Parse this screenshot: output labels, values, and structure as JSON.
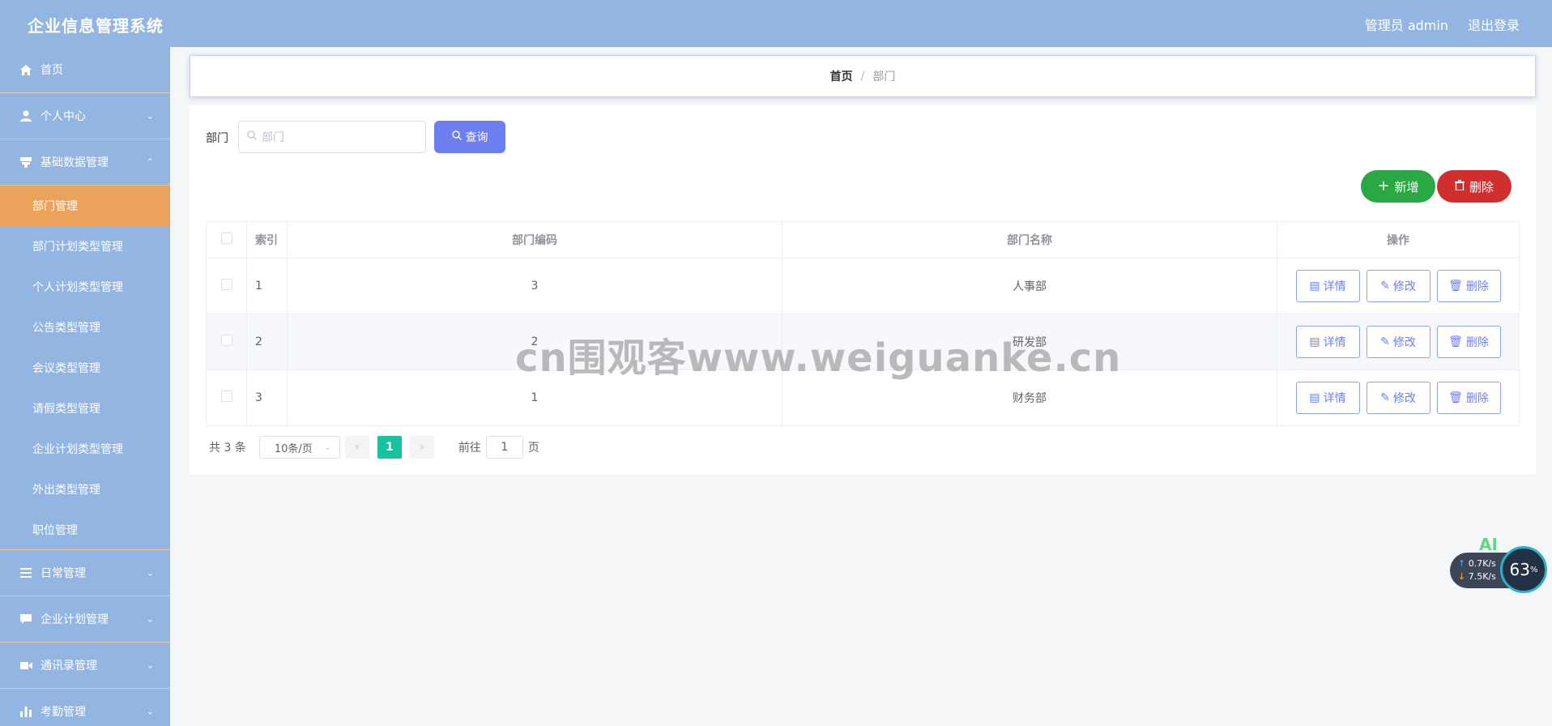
{
  "header": {
    "title": "企业信息管理系统",
    "user": "管理员 admin",
    "logout": "退出登录"
  },
  "sidebar": {
    "top_items": [
      {
        "label": "首页",
        "icon": "home-icon"
      },
      {
        "label": "个人中心",
        "icon": "user-icon"
      },
      {
        "label": "基础数据管理",
        "icon": "database-icon"
      }
    ],
    "sub_items": [
      {
        "label": "部门管理",
        "active": true
      },
      {
        "label": "部门计划类型管理"
      },
      {
        "label": "个人计划类型管理"
      },
      {
        "label": "公告类型管理"
      },
      {
        "label": "会议类型管理"
      },
      {
        "label": "请假类型管理"
      },
      {
        "label": "企业计划类型管理"
      },
      {
        "label": "外出类型管理"
      },
      {
        "label": "职位管理"
      }
    ],
    "bottom_items": [
      {
        "label": "日常管理",
        "icon": "list-icon"
      },
      {
        "label": "企业计划管理",
        "icon": "chat-icon"
      },
      {
        "label": "通讯录管理",
        "icon": "video-icon"
      },
      {
        "label": "考勤管理",
        "icon": "chart-icon"
      }
    ]
  },
  "breadcrumb": {
    "home": "首页",
    "sep": "/",
    "current": "部门"
  },
  "search": {
    "label": "部门",
    "placeholder": "部门",
    "button": "查询"
  },
  "actions": {
    "add": "新增",
    "delete": "删除"
  },
  "table": {
    "headers": {
      "index": "索引",
      "code": "部门编码",
      "name": "部门名称",
      "ops": "操作"
    },
    "rows": [
      {
        "index": "1",
        "code": "3",
        "name": "人事部"
      },
      {
        "index": "2",
        "code": "2",
        "name": "研发部"
      },
      {
        "index": "3",
        "code": "1",
        "name": "财务部"
      }
    ],
    "ops": {
      "detail": "详情",
      "edit": "修改",
      "delete": "删除"
    }
  },
  "pagination": {
    "total": "共 3 条",
    "page_size": "10条/页",
    "current_page": "1",
    "goto_label": "前往",
    "goto_value": "1",
    "goto_suffix": "页"
  },
  "watermark": "cn围观客www.weiguanke.cn",
  "widget": {
    "ai": "AI",
    "up": "0.7",
    "down": "7.5",
    "unit": "K/s",
    "percent": "63",
    "percent_sign": "%"
  }
}
